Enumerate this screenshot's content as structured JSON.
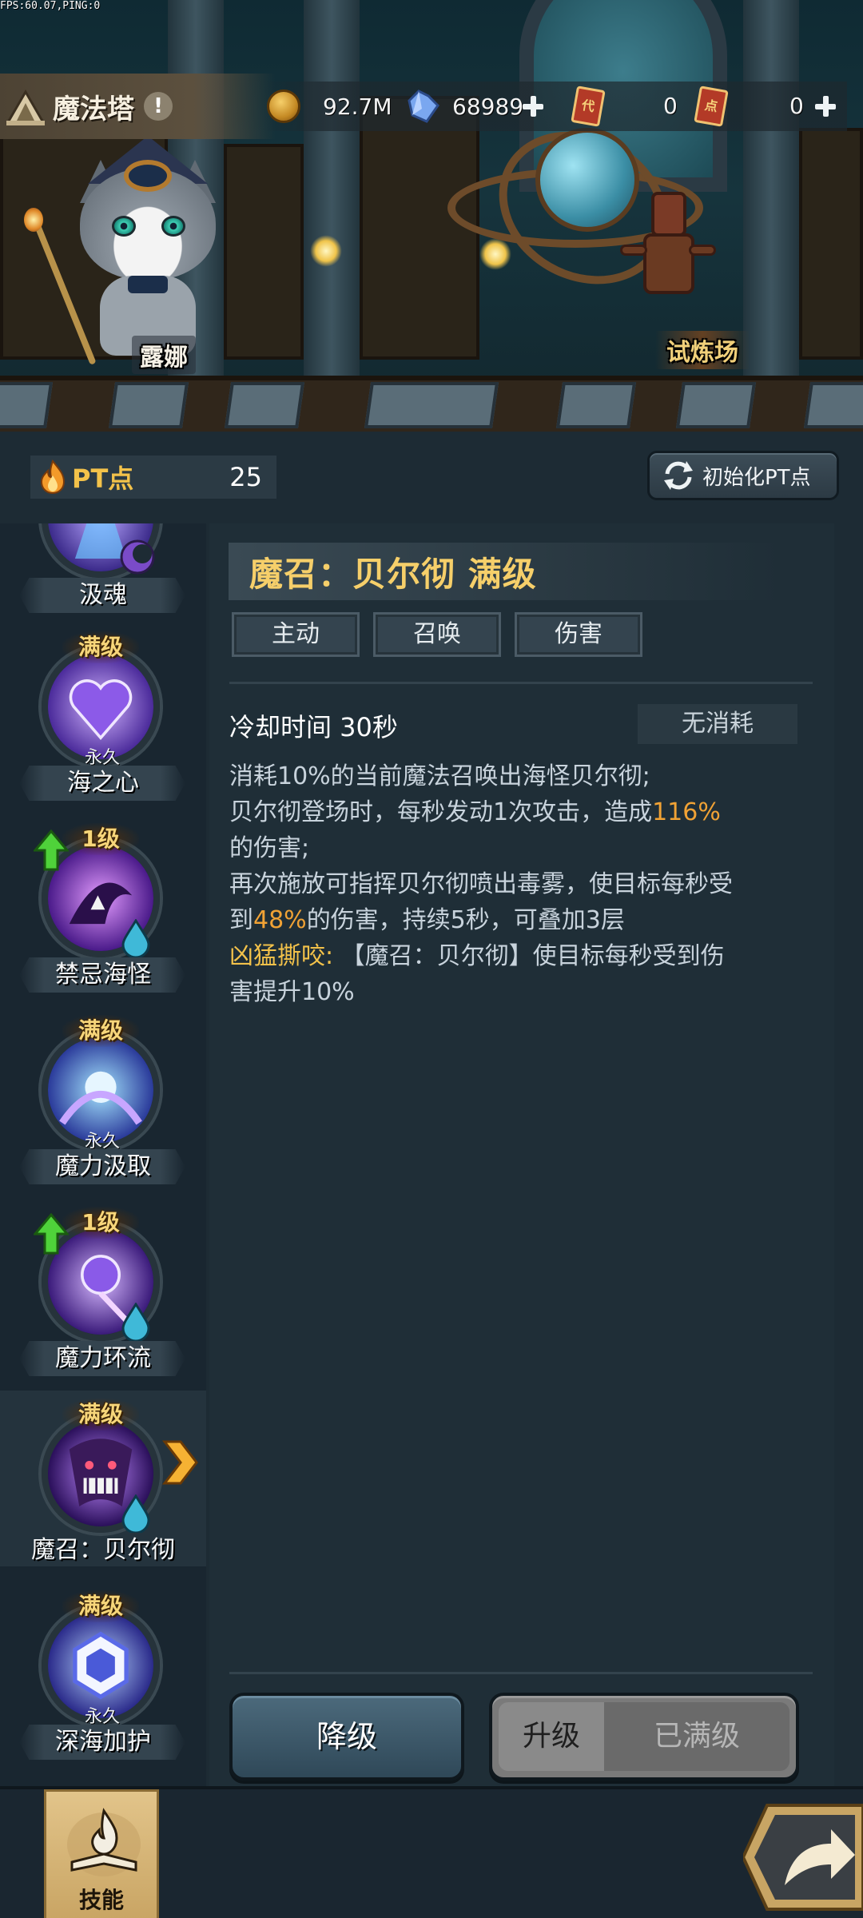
{
  "hud": {
    "fps": "FPS:60.07,PING:0",
    "title": "魔法塔",
    "coins": "92.7M",
    "crystals": "68989",
    "ticket_a": "0",
    "ticket_b": "0",
    "ticket_a_glyph": "代",
    "ticket_b_glyph": "点"
  },
  "scene": {
    "npc_name": "露娜",
    "arena_label": "试炼场"
  },
  "pt": {
    "label": "PT点",
    "value": "25",
    "reset_label": "初始化PT点"
  },
  "skills": [
    {
      "name": "汲魂",
      "badge": "",
      "perm": "",
      "icon": "moon-icon"
    },
    {
      "name": "海之心",
      "badge": "满级",
      "perm": "永久",
      "icon": ""
    },
    {
      "name": "禁忌海怪",
      "badge": "1级",
      "perm": "",
      "icon": "drop-icon"
    },
    {
      "name": "魔力汲取",
      "badge": "满级",
      "perm": "永久",
      "icon": ""
    },
    {
      "name": "魔力环流",
      "badge": "1级",
      "perm": "",
      "icon": "drop-icon"
    },
    {
      "name": "魔召：贝尔彻",
      "badge": "满级",
      "perm": "",
      "icon": "drop-icon",
      "selected": true
    },
    {
      "name": "深海加护",
      "badge": "满级",
      "perm": "永久",
      "icon": ""
    }
  ],
  "detail": {
    "title": "魔召：贝尔彻 满级",
    "tags": [
      "主动",
      "召唤",
      "伤害"
    ],
    "cooldown": "冷却时间 30秒",
    "cost": "无消耗",
    "desc": {
      "l1": "消耗10%的当前魔法召唤出海怪贝尔彻;",
      "l2a": "贝尔彻登场时，每秒发动1次攻击，造成",
      "l2b": "116%",
      "l3": "的伤害;",
      "l4": "再次施放可指挥贝尔彻喷出毒雾，使目标每秒受",
      "l5a": "到",
      "l5b": "48%",
      "l5c": "的伤害，持续5秒，可叠加3层",
      "l6a": "凶猛撕咬:",
      "l6b": " 【魔召：贝尔彻】使目标每秒受到伤",
      "l7": "害提升10%"
    },
    "downgrade_label": "降级",
    "upgrade_label": "升级",
    "maxed_label": "已满级"
  },
  "bottom": {
    "skills_tab_label": "技能"
  },
  "colors": {
    "gold": "#f6cf6a",
    "highlight": "#f0a235",
    "badge": "#f7d67a",
    "panel": "#1d2b34"
  }
}
